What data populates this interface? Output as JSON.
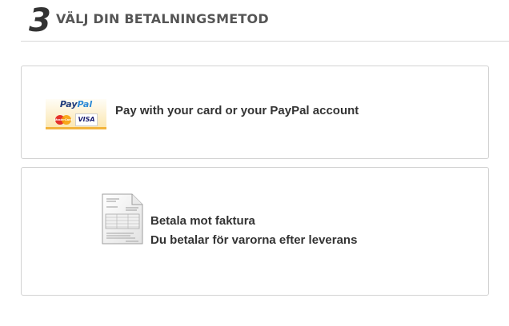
{
  "step": {
    "number": "3",
    "title": "VÄLJ DIN BETALNINGSMETOD"
  },
  "payment_methods": [
    {
      "id": "paypal",
      "icon": "paypal-logo",
      "logo_text": {
        "pay": "Pay",
        "pal": "Pal"
      },
      "cards": [
        "MasterCard",
        "VISA"
      ],
      "label": "Pay with your card or your PayPal account"
    },
    {
      "id": "invoice",
      "icon": "invoice-document-icon",
      "label_line1": "Betala mot faktura",
      "label_line2": "Du betalar för varorna efter leverans"
    }
  ],
  "colors": {
    "border": "#d2d2d2",
    "text": "#333333",
    "paypal_dark_blue": "#1e3a7a",
    "paypal_light_blue": "#2d8ad6",
    "paypal_underline": "#f2b43d"
  }
}
